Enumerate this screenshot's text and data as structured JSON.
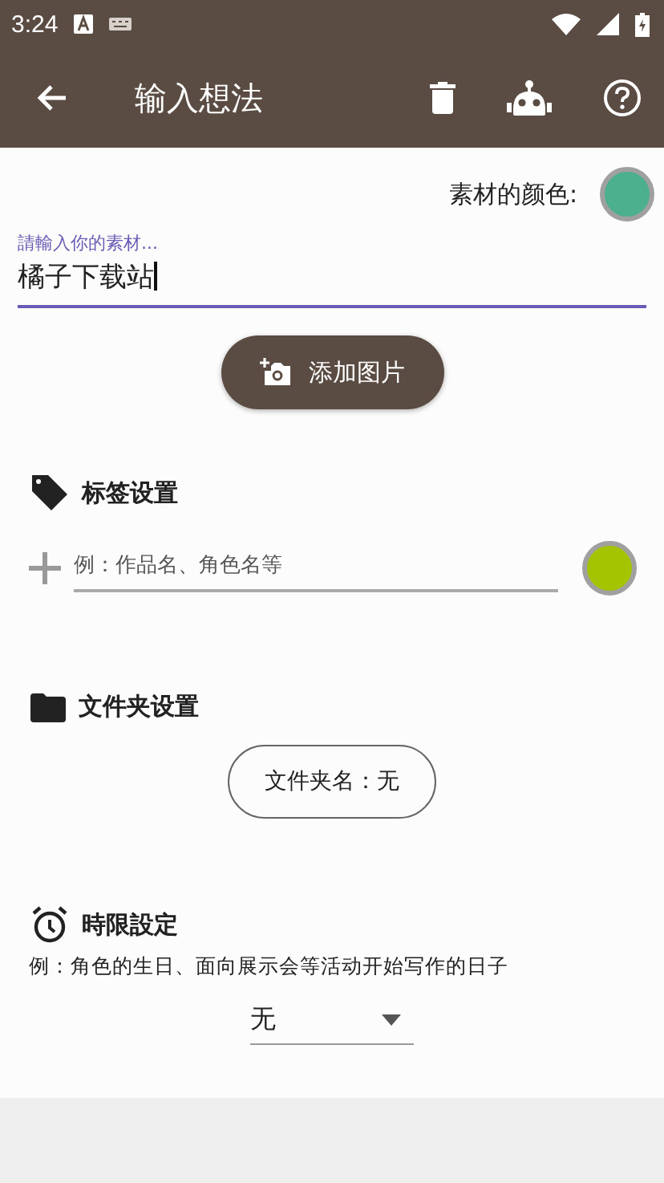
{
  "status_bar": {
    "time": "3:24"
  },
  "app_bar": {
    "title": "输入想法"
  },
  "material_color": {
    "label": "素材的颜色:",
    "color": "#4caf8e"
  },
  "material_field": {
    "label": "請輸入你的素材...",
    "value": "橘子下载站"
  },
  "add_image_button": {
    "label": "添加图片"
  },
  "tag_section": {
    "title": "标签设置",
    "placeholder": "例：作品名、角色名等",
    "color": "#a4c400"
  },
  "folder_section": {
    "title": "文件夹设置",
    "button": "文件夹名：无"
  },
  "deadline_section": {
    "title": "時限設定",
    "description": "例：角色的生日、面向展示会等活动开始写作的日子",
    "dropdown": "无"
  }
}
